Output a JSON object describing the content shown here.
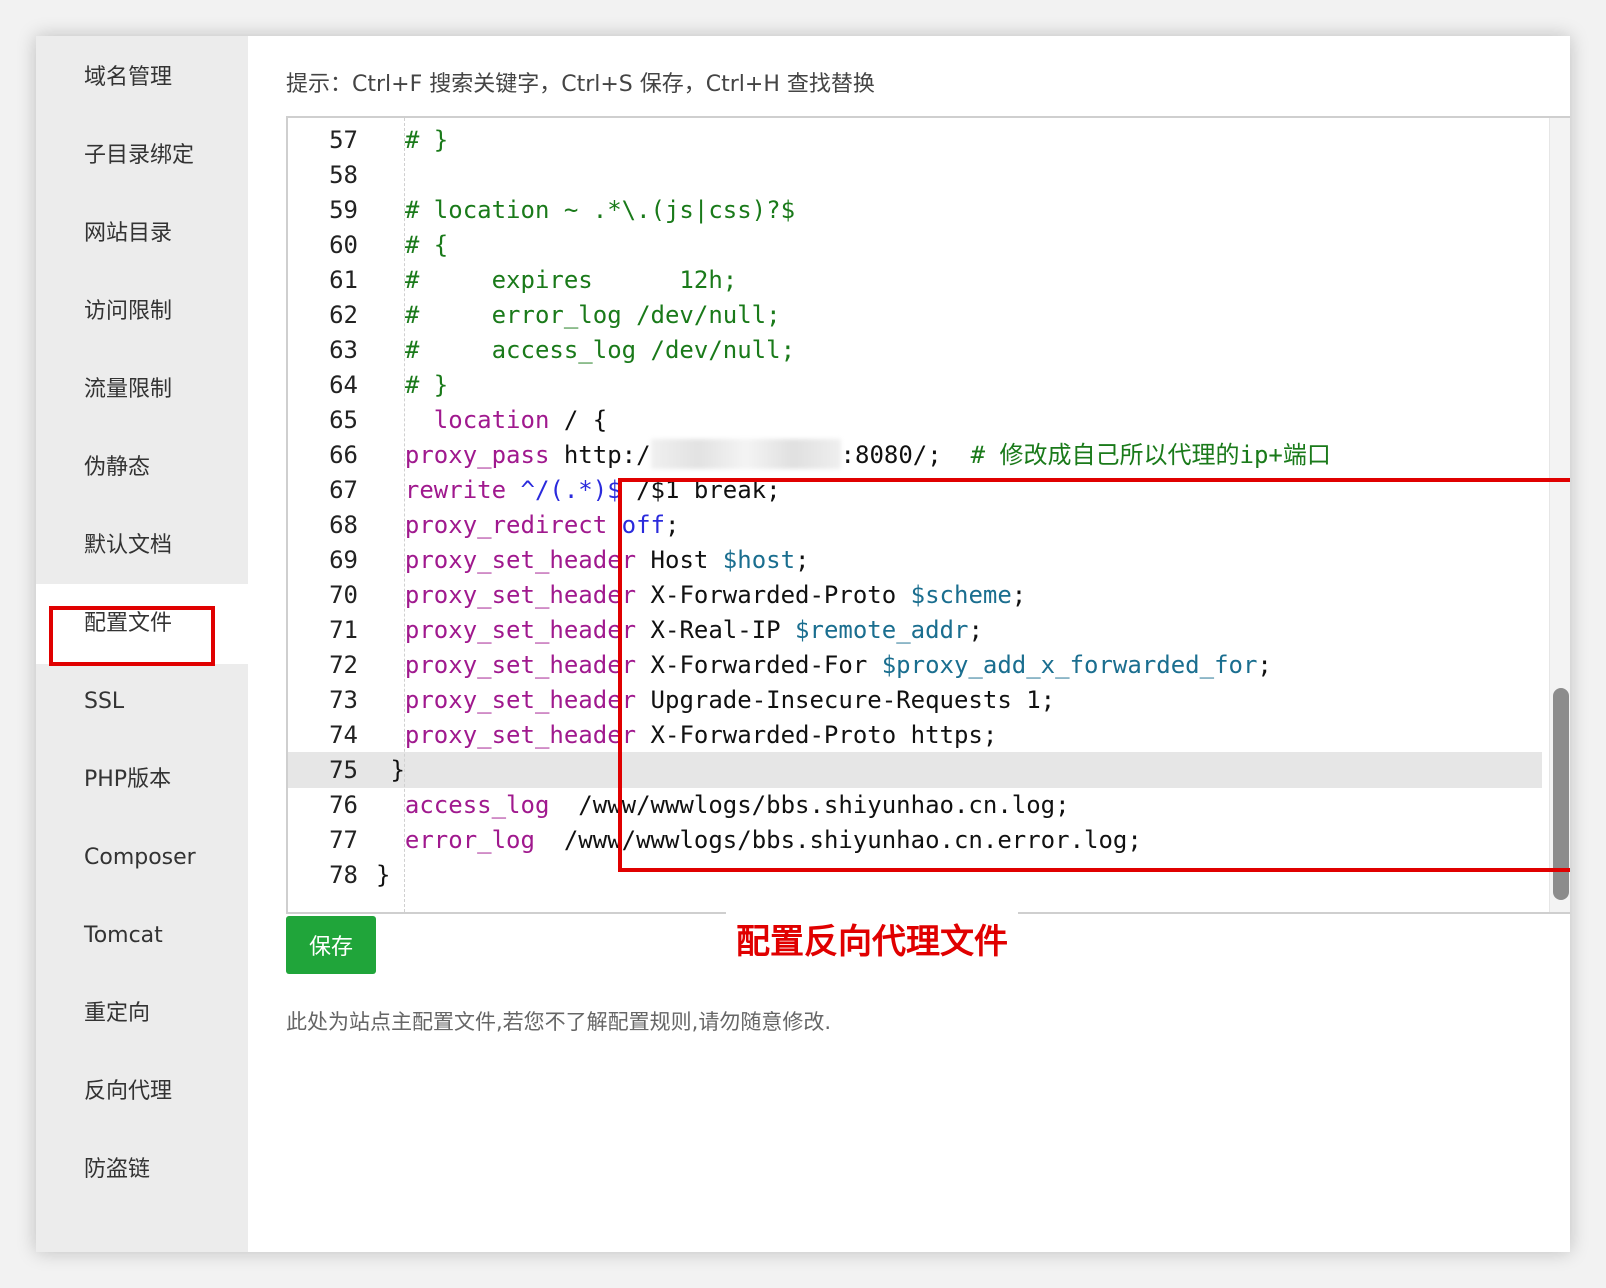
{
  "sidebar": {
    "items": [
      {
        "label": "域名管理"
      },
      {
        "label": "子目录绑定"
      },
      {
        "label": "网站目录"
      },
      {
        "label": "访问限制"
      },
      {
        "label": "流量限制"
      },
      {
        "label": "伪静态"
      },
      {
        "label": "默认文档"
      },
      {
        "label": "配置文件"
      },
      {
        "label": "SSL"
      },
      {
        "label": "PHP版本"
      },
      {
        "label": "Composer"
      },
      {
        "label": "Tomcat"
      },
      {
        "label": "重定向"
      },
      {
        "label": "反向代理"
      },
      {
        "label": "防盗链"
      }
    ],
    "active_item": "配置文件"
  },
  "main": {
    "hint": "提示：Ctrl+F 搜索关键字，Ctrl+S 保存，Ctrl+H 查找替换",
    "editor": {
      "current_line": 75,
      "lines": [
        {
          "n": "57",
          "parts": [
            {
              "t": "  # }",
              "c": "k-green"
            }
          ]
        },
        {
          "n": "58",
          "parts": []
        },
        {
          "n": "59",
          "parts": [
            {
              "t": "  # location ~ .*\\.(js|css)?$",
              "c": "k-green"
            }
          ]
        },
        {
          "n": "60",
          "parts": [
            {
              "t": "  # {",
              "c": "k-green"
            }
          ]
        },
        {
          "n": "61",
          "parts": [
            {
              "t": "  #     expires      12h;",
              "c": "k-green"
            }
          ]
        },
        {
          "n": "62",
          "parts": [
            {
              "t": "  #     error_log /dev/null;",
              "c": "k-green"
            }
          ]
        },
        {
          "n": "63",
          "parts": [
            {
              "t": "  #     access_log /dev/null;",
              "c": "k-green"
            }
          ]
        },
        {
          "n": "64",
          "parts": [
            {
              "t": "  # }",
              "c": "k-green"
            }
          ]
        },
        {
          "n": "65",
          "parts": [
            {
              "t": "    location",
              "c": "k-purple"
            },
            {
              "t": " / {",
              "c": ""
            }
          ]
        },
        {
          "n": "66",
          "parts": [
            {
              "t": "  proxy_pass",
              "c": "k-purple"
            },
            {
              "t": " http:/",
              "c": ""
            },
            {
              "t": "[BLUR]",
              "c": "blur"
            },
            {
              "t": ":8080/;  ",
              "c": ""
            },
            {
              "t": "# 修改成自己所以代理的ip+端口",
              "c": "k-green"
            }
          ]
        },
        {
          "n": "67",
          "parts": [
            {
              "t": "  rewrite",
              "c": "k-purple"
            },
            {
              "t": " ^/(.*)$",
              "c": "k-blue"
            },
            {
              "t": " /$1 break;",
              "c": ""
            }
          ]
        },
        {
          "n": "68",
          "parts": [
            {
              "t": "  proxy_redirect",
              "c": "k-purple"
            },
            {
              "t": " off",
              "c": "k-blue"
            },
            {
              "t": ";",
              "c": ""
            }
          ]
        },
        {
          "n": "69",
          "parts": [
            {
              "t": "  proxy_set_header",
              "c": "k-purple"
            },
            {
              "t": " Host ",
              "c": ""
            },
            {
              "t": "$host",
              "c": "k-teal"
            },
            {
              "t": ";",
              "c": ""
            }
          ]
        },
        {
          "n": "70",
          "parts": [
            {
              "t": "  proxy_set_header",
              "c": "k-purple"
            },
            {
              "t": " X-Forwarded-Proto ",
              "c": ""
            },
            {
              "t": "$scheme",
              "c": "k-teal"
            },
            {
              "t": ";",
              "c": ""
            }
          ]
        },
        {
          "n": "71",
          "parts": [
            {
              "t": "  proxy_set_header",
              "c": "k-purple"
            },
            {
              "t": " X-Real-IP ",
              "c": ""
            },
            {
              "t": "$remote_addr",
              "c": "k-teal"
            },
            {
              "t": ";",
              "c": ""
            }
          ]
        },
        {
          "n": "72",
          "parts": [
            {
              "t": "  proxy_set_header",
              "c": "k-purple"
            },
            {
              "t": " X-Forwarded-For ",
              "c": ""
            },
            {
              "t": "$proxy_add_x_forwarded_for",
              "c": "k-teal"
            },
            {
              "t": ";",
              "c": ""
            }
          ]
        },
        {
          "n": "73",
          "parts": [
            {
              "t": "  proxy_set_header",
              "c": "k-purple"
            },
            {
              "t": " Upgrade-Insecure-Requests 1;",
              "c": ""
            }
          ]
        },
        {
          "n": "74",
          "parts": [
            {
              "t": "  proxy_set_header",
              "c": "k-purple"
            },
            {
              "t": " X-Forwarded-Proto https;",
              "c": ""
            }
          ]
        },
        {
          "n": "75",
          "parts": [
            {
              "t": " }",
              "c": ""
            }
          ]
        },
        {
          "n": "76",
          "parts": [
            {
              "t": "  access_log",
              "c": "k-purple"
            },
            {
              "t": "  /www/wwwlogs/bbs.shiyunhao.cn.log;",
              "c": ""
            }
          ]
        },
        {
          "n": "77",
          "parts": [
            {
              "t": "  error_log",
              "c": "k-purple"
            },
            {
              "t": "  /www/wwwlogs/bbs.shiyunhao.cn.error.log;",
              "c": ""
            }
          ]
        },
        {
          "n": "78",
          "parts": [
            {
              "t": "}",
              "c": ""
            }
          ]
        }
      ]
    },
    "save_label": "保存",
    "annotation": "配置反向代理文件",
    "footnote": "此处为站点主配置文件,若您不了解配置规则,请勿随意修改."
  },
  "colors": {
    "highlight": "#e00000",
    "save_button": "#20a53a",
    "comment": "#1a7a1a",
    "keyword": "#a0198e",
    "variable": "#1a6e8f"
  }
}
